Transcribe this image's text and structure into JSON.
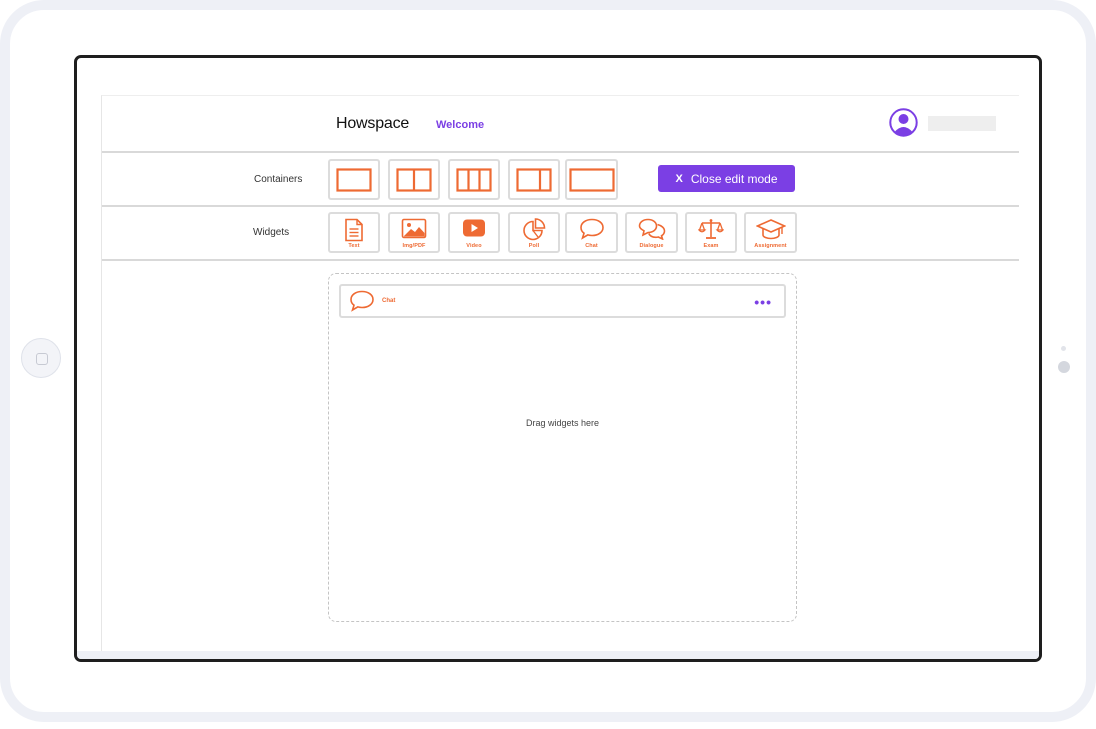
{
  "header": {
    "logo": "Howspace",
    "page_title": "Welcome"
  },
  "toolbar": {
    "containers_label": "Containers",
    "widgets_label": "Widgets",
    "close_edit_mode": {
      "icon": "X",
      "label": "Close edit mode"
    },
    "container_layouts": [
      "single-column-layout-icon",
      "two-column-layout-icon",
      "three-column-layout-icon",
      "wide-left-layout-icon",
      "full-width-layout-icon"
    ],
    "widgets": [
      {
        "label": "Text",
        "icon": "document-icon"
      },
      {
        "label": "Img/PDF",
        "icon": "image-icon"
      },
      {
        "label": "Video",
        "icon": "play-icon"
      },
      {
        "label": "Poll",
        "icon": "pie-chart-icon"
      },
      {
        "label": "Chat",
        "icon": "speech-bubble-icon"
      },
      {
        "label": "Dialogue",
        "icon": "dialogue-bubbles-icon"
      },
      {
        "label": "Exam",
        "icon": "scales-icon"
      },
      {
        "label": "Assignment",
        "icon": "graduation-cap-icon"
      }
    ]
  },
  "canvas": {
    "chat_widget_label": "Chat",
    "more_menu": "•••",
    "drop_hint": "Drag widgets here"
  },
  "colors": {
    "accent": "#7b3fe4",
    "widget_orange": "#ee6a33",
    "border_gray": "#dcdcdc"
  }
}
